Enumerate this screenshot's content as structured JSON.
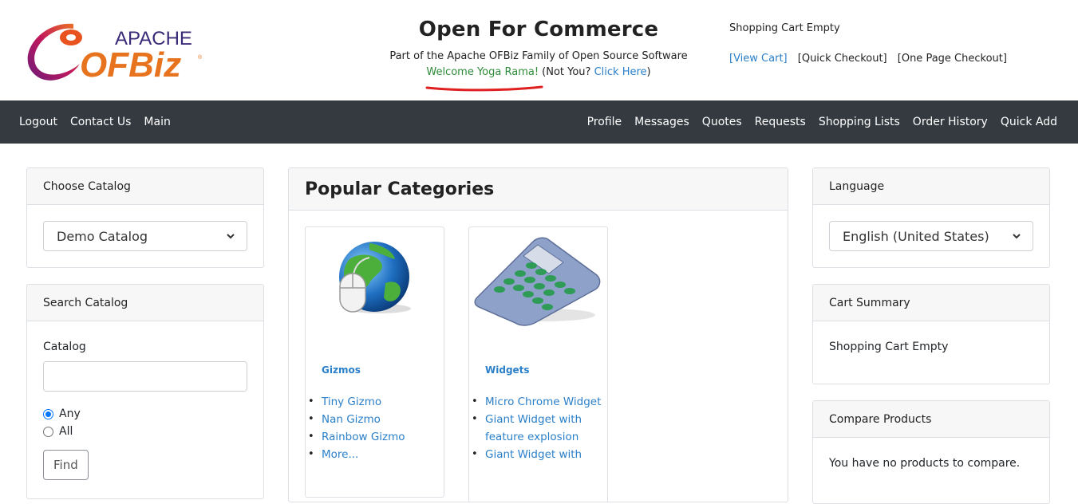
{
  "header": {
    "title": "Open For Commerce",
    "subtitle": "Part of the Apache OFBiz Family of Open Source Software",
    "welcome_name": "Welcome Yoga Rama!",
    "not_you": " (Not You? ",
    "click_here": "Click Here",
    "close_paren": ")",
    "cart_status": "Shopping Cart Empty",
    "view_cart": "[View Cart]",
    "quick_checkout": "[Quick Checkout]",
    "one_page_checkout": "[One Page Checkout]",
    "logo_apache": "APACHE",
    "logo_ofbiz": "OFBiz"
  },
  "nav": {
    "left": [
      "Logout",
      "Contact Us",
      "Main"
    ],
    "right": [
      "Profile",
      "Messages",
      "Quotes",
      "Requests",
      "Shopping Lists",
      "Order History",
      "Quick Add"
    ]
  },
  "choose_catalog": {
    "title": "Choose Catalog",
    "selected": "Demo Catalog"
  },
  "search_catalog": {
    "title": "Search Catalog",
    "catalog_label": "Catalog",
    "input_value": "",
    "opt_any": "Any",
    "opt_all": "All",
    "find": "Find"
  },
  "popular": {
    "title": "Popular Categories",
    "categories": [
      {
        "name": "Gizmos",
        "items": [
          "Tiny Gizmo",
          "Nan Gizmo",
          "Rainbow Gizmo",
          "More..."
        ]
      },
      {
        "name": "Widgets",
        "items": [
          "Micro Chrome Widget",
          "Giant Widget with feature explosion",
          "Giant Widget with"
        ]
      }
    ]
  },
  "language": {
    "title": "Language",
    "selected": "English (United States)"
  },
  "cart_summary": {
    "title": "Cart Summary",
    "text": "Shopping Cart Empty"
  },
  "compare": {
    "title": "Compare Products",
    "text": "You have no products to compare."
  },
  "colors": {
    "navbar": "#343a40",
    "link": "#2a7fc9",
    "welcome_green": "#2e8b3a",
    "annotation_red": "#e02020"
  }
}
